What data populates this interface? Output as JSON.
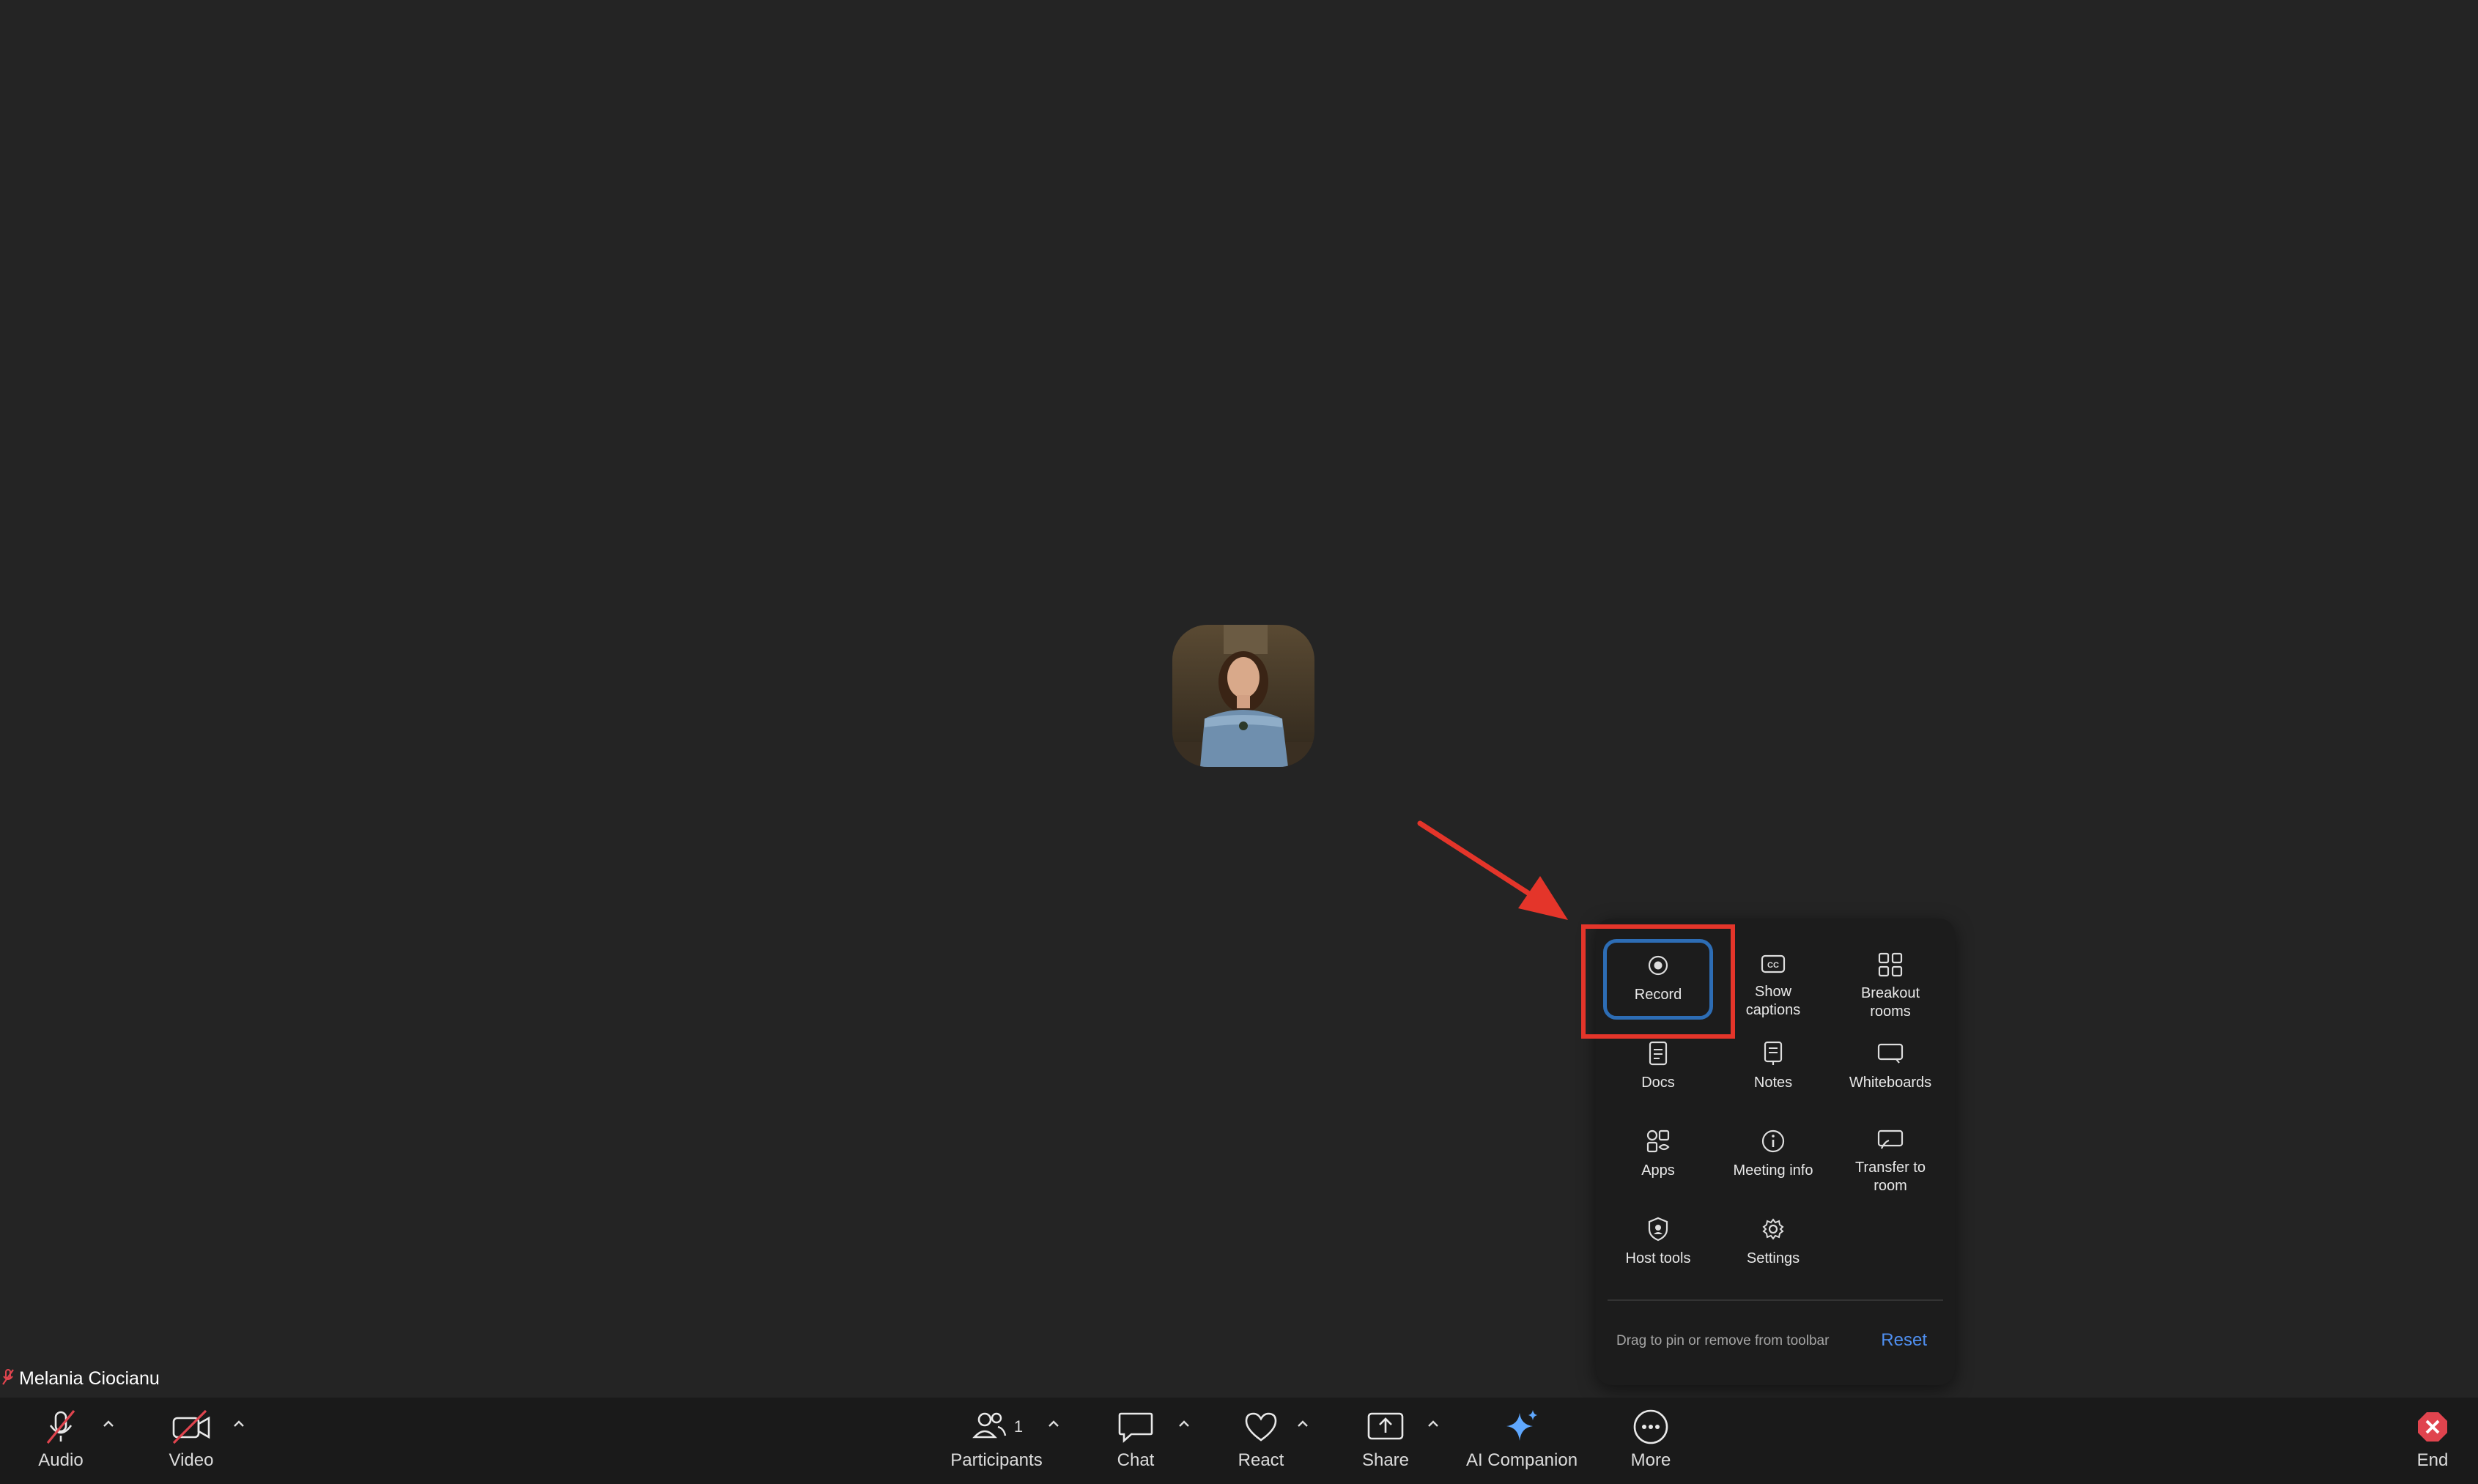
{
  "participant": {
    "name": "Melania Ciocianu"
  },
  "more_menu": {
    "items": [
      {
        "label": "Record",
        "icon": "record-icon"
      },
      {
        "label": "Show captions",
        "icon": "captions-icon"
      },
      {
        "label": "Breakout rooms",
        "icon": "breakout-rooms-icon"
      },
      {
        "label": "Docs",
        "icon": "docs-icon"
      },
      {
        "label": "Notes",
        "icon": "notes-icon"
      },
      {
        "label": "Whiteboards",
        "icon": "whiteboard-icon"
      },
      {
        "label": "Apps",
        "icon": "apps-icon"
      },
      {
        "label": "Meeting info",
        "icon": "info-icon"
      },
      {
        "label": "Transfer to room",
        "icon": "transfer-icon"
      },
      {
        "label": "Host tools",
        "icon": "host-tools-icon"
      },
      {
        "label": "Settings",
        "icon": "gear-icon"
      }
    ],
    "hint": "Drag to pin or remove from toolbar",
    "reset_label": "Reset"
  },
  "toolbar": {
    "audio_label": "Audio",
    "video_label": "Video",
    "participants_label": "Participants",
    "participants_count": "1",
    "chat_label": "Chat",
    "react_label": "React",
    "share_label": "Share",
    "ai_companion_label": "AI Companion",
    "more_label": "More",
    "end_label": "End"
  },
  "colors": {
    "background": "#242424",
    "toolbar": "#1a1a1a",
    "menu": "#1c1c1c",
    "accent_blue": "#4f8ff0",
    "focus_ring": "#2d6db5",
    "annotation_red": "#e4352a",
    "muted_red": "#e0444e"
  }
}
